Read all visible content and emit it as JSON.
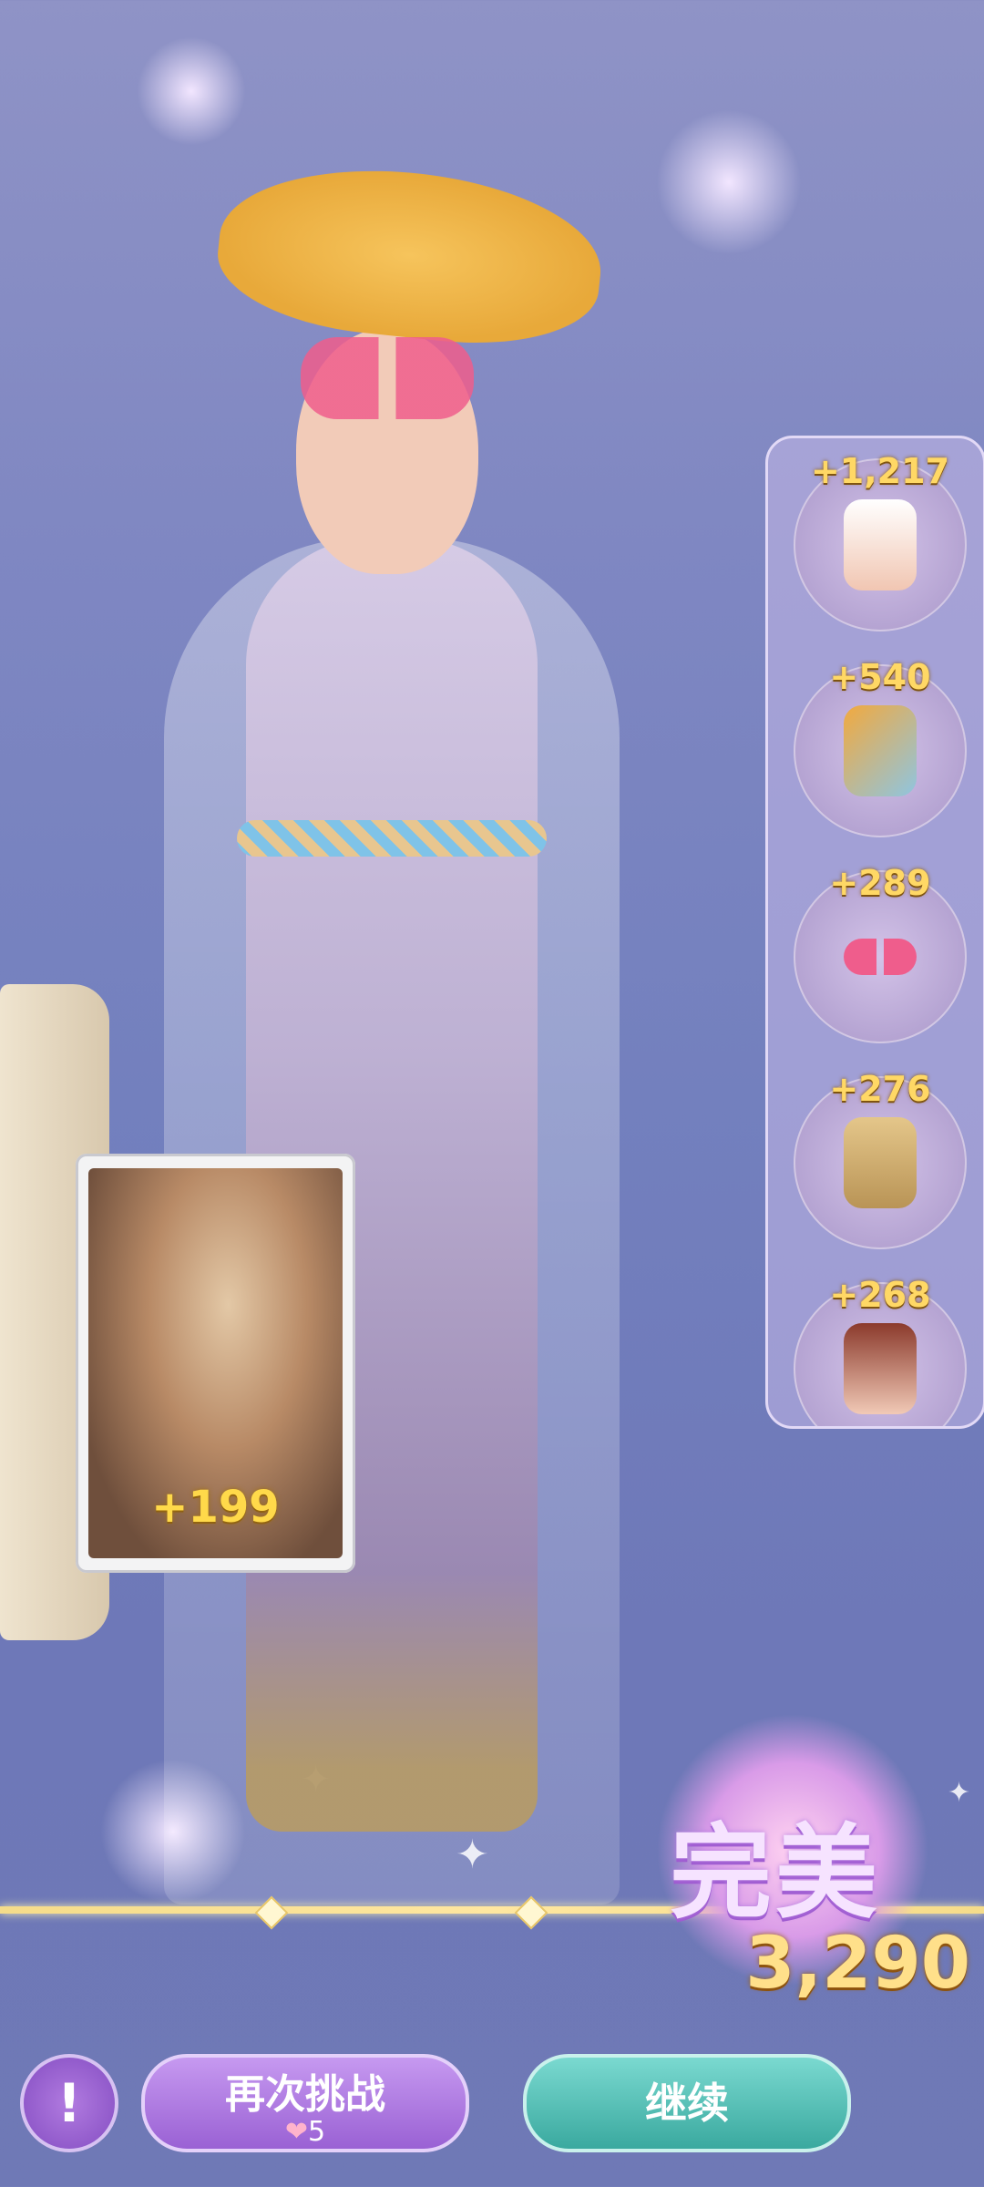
{
  "bonus_card": {
    "value": "+199"
  },
  "score_items": [
    {
      "points": "+1,217",
      "item": "dress-icon"
    },
    {
      "points": "+540",
      "item": "sandals-icon"
    },
    {
      "points": "+289",
      "item": "sunglasses-icon"
    },
    {
      "points": "+276",
      "item": "hairstyle-icon"
    },
    {
      "points": "+268",
      "item": "makeup-icon"
    }
  ],
  "result": {
    "label": "完美",
    "total_score": "3,290"
  },
  "buttons": {
    "alert_icon": "!",
    "retry_label": "再次挑战",
    "retry_cost": "5",
    "continue_label": "继续"
  },
  "colors": {
    "score_gold": "#ffd865",
    "retry_purple": "#9a61d4",
    "continue_teal": "#3aa99f"
  }
}
